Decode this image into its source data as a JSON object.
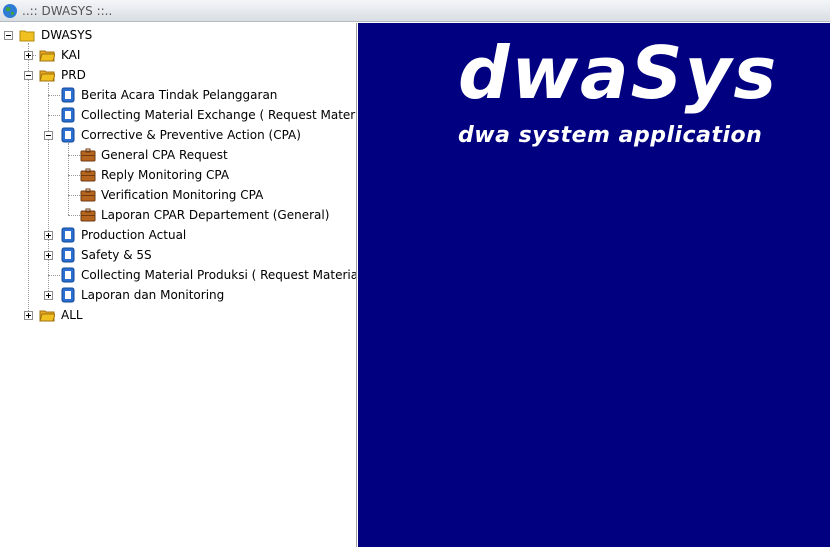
{
  "window": {
    "title": "..:: DWASYS ::.."
  },
  "tree": {
    "root": "DWASYS",
    "kai": "KAI",
    "prd": "PRD",
    "prd_items": {
      "berita": "Berita Acara Tindak Pelanggaran",
      "collecting_exchange": "Collecting Material Exchange ( Request Material E",
      "cpa": "Corrective & Preventive Action (CPA)",
      "cpa_items": {
        "general": "General CPA Request",
        "reply": "Reply Monitoring CPA",
        "verification": "Verification Monitoring CPA",
        "laporan_cpar": "Laporan CPAR Departement (General)"
      },
      "production_actual": "Production Actual",
      "safety": "Safety & 5S",
      "collecting_produksi": "Collecting Material Produksi ( Request Material )",
      "laporan_monitoring": "Laporan dan Monitoring"
    },
    "all": "ALL"
  },
  "brand": {
    "logo": "dwaSys",
    "tagline": "dwa system application"
  },
  "colors": {
    "content_bg": "#000080",
    "folder": "#f0c020",
    "box": "#b5651d",
    "app_icon": "#2a6fd0"
  }
}
